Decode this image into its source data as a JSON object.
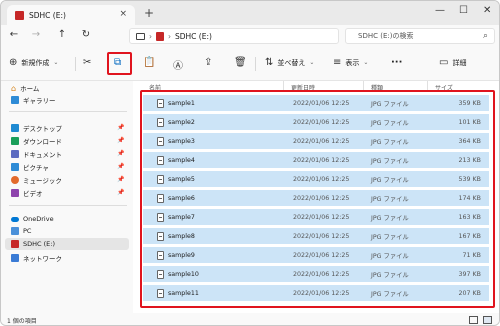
{
  "tab": {
    "title": "SDHC (E:)",
    "close": "×",
    "new": "+"
  },
  "window_controls": {
    "minimize": "—",
    "maximize": "☐",
    "close": "✕"
  },
  "address": {
    "path_sep": "›",
    "location": "SDHC (E:)",
    "chevron": "›"
  },
  "search": {
    "placeholder": "SDHC (E:)の検索",
    "icon": "search-icon"
  },
  "toolbar": {
    "new_label": "新規作成",
    "sort_label": "並べ替え",
    "view_label": "表示",
    "more_label": "···",
    "details_label": "詳細"
  },
  "sidebar": {
    "quick": [
      {
        "label": "ホーム",
        "icon": "home-icon"
      },
      {
        "label": "ギャラリー",
        "icon": "gallery-icon"
      }
    ],
    "pinned": [
      {
        "label": "デスクトップ",
        "icon": "desktop-icon"
      },
      {
        "label": "ダウンロード",
        "icon": "download-icon"
      },
      {
        "label": "ドキュメント",
        "icon": "document-icon"
      },
      {
        "label": "ピクチャ",
        "icon": "pictures-icon"
      },
      {
        "label": "ミュージック",
        "icon": "music-icon"
      },
      {
        "label": "ビデオ",
        "icon": "video-icon"
      }
    ],
    "drives": [
      {
        "label": "OneDrive",
        "icon": "onedrive-icon"
      },
      {
        "label": "PC",
        "icon": "pc-icon"
      },
      {
        "label": "SDHC (E:)",
        "icon": "sd-card-icon"
      },
      {
        "label": "ネットワーク",
        "icon": "network-icon"
      }
    ]
  },
  "columns": {
    "name": "名前",
    "date": "更新日時",
    "type": "種類",
    "size": "サイズ"
  },
  "files": [
    {
      "name": "sample1",
      "date": "2022/01/06 12:25",
      "type": "JPG ファイル",
      "size": "359 KB"
    },
    {
      "name": "sample2",
      "date": "2022/01/06 12:25",
      "type": "JPG ファイル",
      "size": "101 KB"
    },
    {
      "name": "sample3",
      "date": "2022/01/06 12:25",
      "type": "JPG ファイル",
      "size": "364 KB"
    },
    {
      "name": "sample4",
      "date": "2022/01/06 12:25",
      "type": "JPG ファイル",
      "size": "213 KB"
    },
    {
      "name": "sample5",
      "date": "2022/01/06 12:25",
      "type": "JPG ファイル",
      "size": "539 KB"
    },
    {
      "name": "sample6",
      "date": "2022/01/06 12:25",
      "type": "JPG ファイル",
      "size": "174 KB"
    },
    {
      "name": "sample7",
      "date": "2022/01/06 12:25",
      "type": "JPG ファイル",
      "size": "163 KB"
    },
    {
      "name": "sample8",
      "date": "2022/01/06 12:25",
      "type": "JPG ファイル",
      "size": "167 KB"
    },
    {
      "name": "sample9",
      "date": "2022/01/06 12:25",
      "type": "JPG ファイル",
      "size": "71 KB"
    },
    {
      "name": "sample10",
      "date": "2022/01/06 12:25",
      "type": "JPG ファイル",
      "size": "397 KB"
    },
    {
      "name": "sample11",
      "date": "2022/01/06 12:25",
      "type": "JPG ファイル",
      "size": "207 KB"
    }
  ],
  "status": {
    "text": "1 個の項目"
  },
  "colors": {
    "selection": "#cce4f7",
    "highlight": "#e0141e",
    "accent": "#0067c0"
  }
}
